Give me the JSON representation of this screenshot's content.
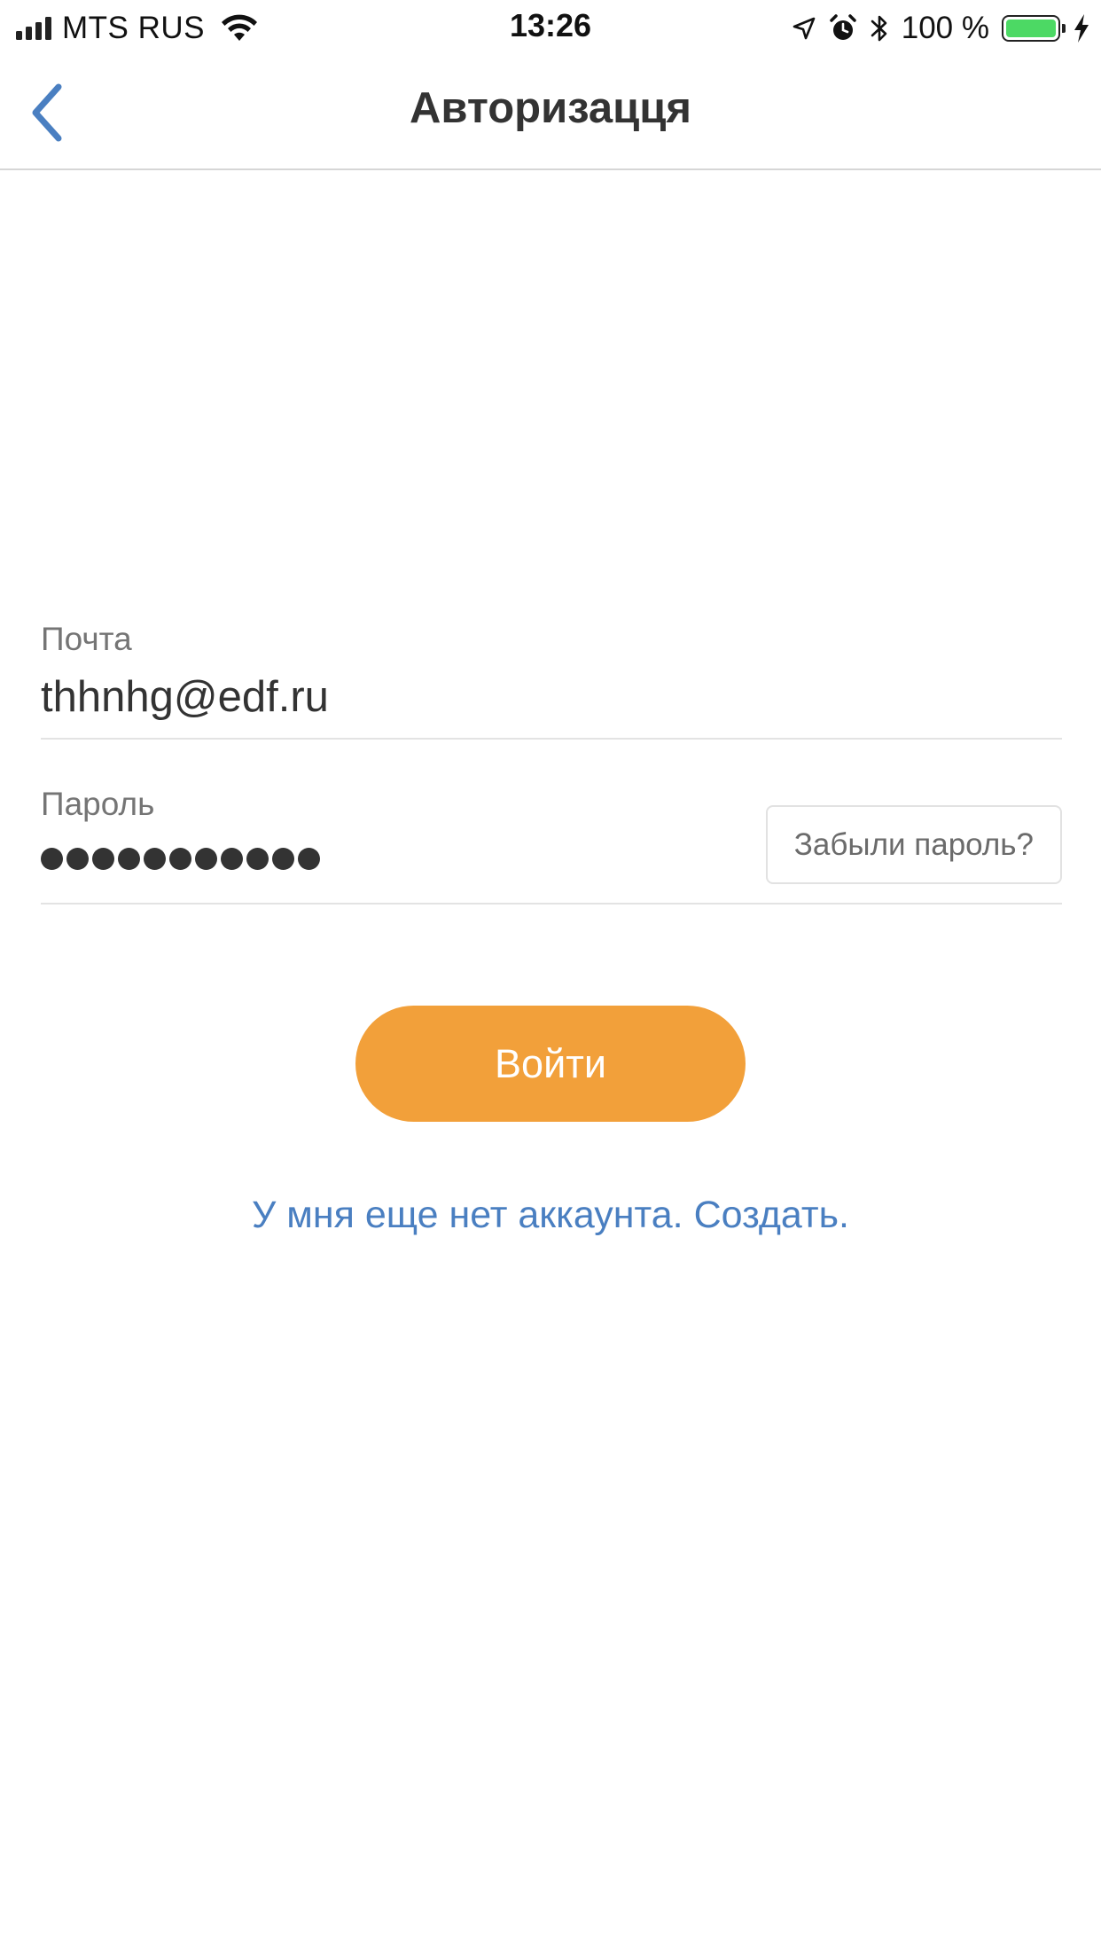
{
  "status_bar": {
    "carrier": "MTS RUS",
    "time": "13:26",
    "battery_percent": "100 %",
    "battery_level": 1.0,
    "icons": [
      "signal-icon",
      "wifi-icon",
      "location-arrow-icon",
      "alarm-icon",
      "bluetooth-icon",
      "battery-icon",
      "charging-bolt-icon"
    ],
    "battery_color": "#4cd964"
  },
  "nav": {
    "title": "Авторизацця",
    "back_icon": "chevron-left-icon",
    "back_color": "#4a7fc1"
  },
  "form": {
    "email": {
      "label": "Почта",
      "value": "thhnhg@edf.ru"
    },
    "password": {
      "label": "Пароль",
      "masked_length": 11,
      "forgot_label": "Забыли пароль?"
    }
  },
  "login_button": {
    "label": "Войти",
    "color": "#f2a03a"
  },
  "signup_link": {
    "label": "У мня еще нет аккаунта. Создать.",
    "color": "#4a7fc1"
  }
}
